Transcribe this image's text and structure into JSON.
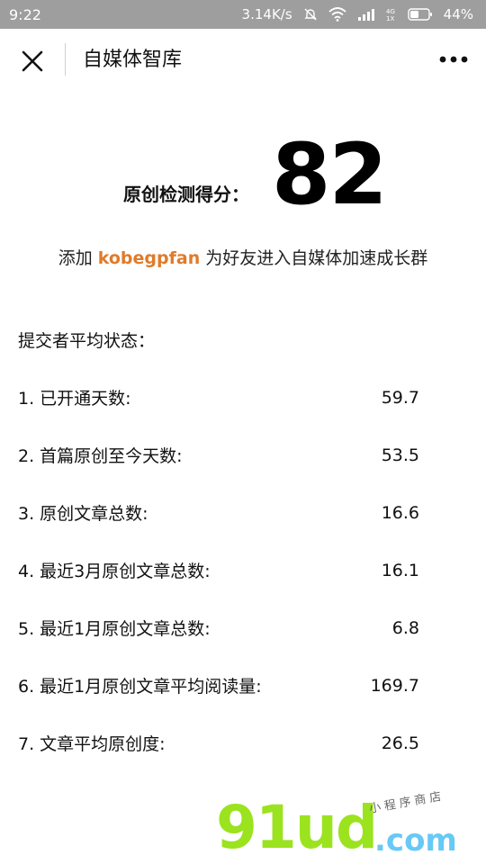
{
  "status_bar": {
    "time": "9:22",
    "network_speed": "3.14K/s",
    "battery_percent": "44%",
    "icons": [
      "mute-icon",
      "wifi-icon",
      "signal-icon",
      "4g-icon",
      "battery-icon"
    ]
  },
  "title_bar": {
    "title": "自媒体智库",
    "close_icon": "close-icon",
    "more_icon": "more-icon"
  },
  "score": {
    "label": "原创检测得分：",
    "value": "82"
  },
  "invite": {
    "prefix": "添加 ",
    "id": "kobegpfan",
    "suffix": " 为好友进入自媒体加速成长群"
  },
  "stats": {
    "header": "提交者平均状态：",
    "items": [
      {
        "label": "1. 已开通天数:",
        "value": "59.7"
      },
      {
        "label": "2. 首篇原创至今天数:",
        "value": "53.5"
      },
      {
        "label": "3. 原创文章总数:",
        "value": "16.6"
      },
      {
        "label": "4. 最近3月原创文章总数:",
        "value": "16.1"
      },
      {
        "label": "5. 最近1月原创文章总数:",
        "value": "6.8"
      },
      {
        "label": "6. 最近1月原创文章平均阅读量:",
        "value": "169.7"
      },
      {
        "label": "7. 文章平均原创度:",
        "value": "26.5"
      }
    ]
  },
  "watermark": {
    "main": "91ud",
    "suffix": ".com",
    "sub": "小程序商店"
  },
  "colors": {
    "status_bar_bg": "#9e9e9e",
    "invite_id": "#e07b2a",
    "watermark_main": "#9be31f",
    "watermark_suffix": "#67c9f5"
  }
}
